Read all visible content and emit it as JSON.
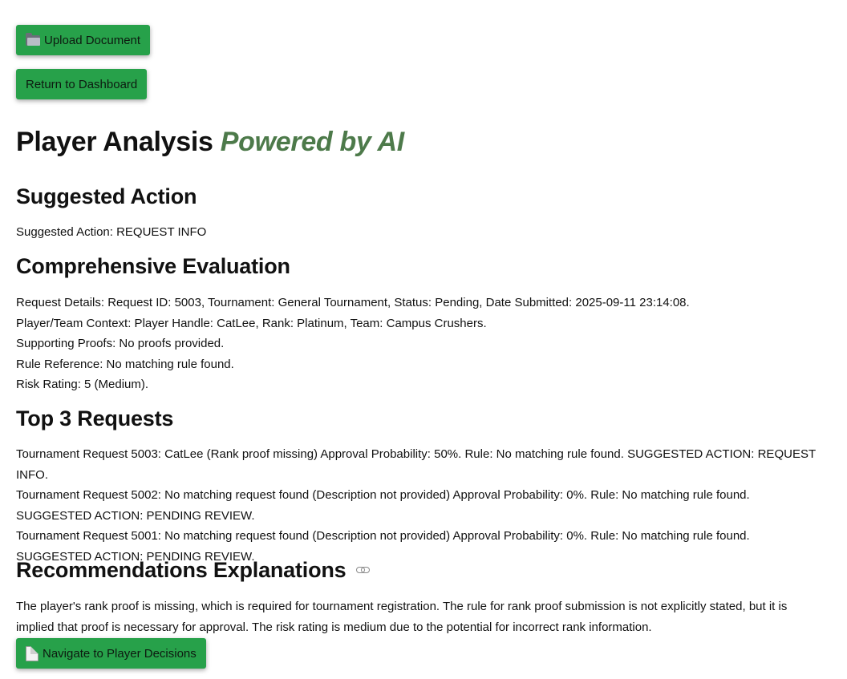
{
  "buttons": {
    "upload_label": "Upload Document",
    "return_label": "Return to Dashboard",
    "navigate_label": "Navigate to Player Decisions"
  },
  "icons": {
    "upload": "folder-icon",
    "navigate": "page-icon",
    "anchor": "link-icon"
  },
  "header": {
    "title": "Player Analysis",
    "tagline": "Powered by AI"
  },
  "suggested": {
    "heading": "Suggested Action",
    "text": "Suggested Action: REQUEST INFO"
  },
  "evaluation": {
    "heading": "Comprehensive Evaluation",
    "lines": [
      "Request Details: Request ID: 5003, Tournament: General Tournament, Status: Pending, Date Submitted: 2025-09-11 23:14:08.",
      "Player/Team Context: Player Handle: CatLee, Rank: Platinum, Team: Campus Crushers.",
      "Supporting Proofs: No proofs provided.",
      "Rule Reference: No matching rule found.",
      "Risk Rating: 5 (Medium)."
    ]
  },
  "top_requests": {
    "heading": "Top 3 Requests",
    "items": [
      "Tournament Request 5003: CatLee (Rank proof missing) Approval Probability: 50%. Rule: No matching rule found. SUGGESTED ACTION: REQUEST INFO.",
      "Tournament Request 5002: No matching request found (Description not provided) Approval Probability: 0%. Rule: No matching rule found. SUGGESTED ACTION: PENDING REVIEW.",
      "Tournament Request 5001: No matching request found (Description not provided) Approval Probability: 0%. Rule: No matching rule found. SUGGESTED ACTION: PENDING REVIEW."
    ]
  },
  "recommendations": {
    "heading": "Recommendations Explanations",
    "text": "The player's rank proof is missing, which is required for tournament registration. The rule for rank proof submission is not explicitly stated, but it is implied that proof is necessary for approval. The risk rating is medium due to the potential for incorrect rank information."
  },
  "colors": {
    "button_bg": "#27a14a",
    "tagline": "#4d7a4a"
  }
}
